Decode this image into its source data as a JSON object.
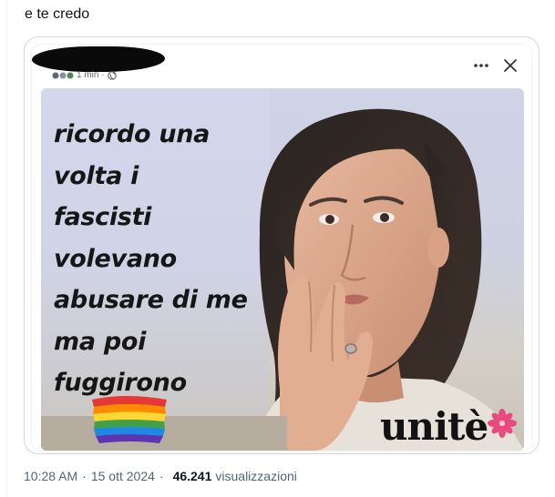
{
  "tweet": {
    "text": "e te credo",
    "time": "10:28 AM",
    "separator": "·",
    "date": "15 ott 2024",
    "views_count": "46.241",
    "views_label": "visualizzazioni"
  },
  "embedded_post": {
    "timestamp": "1 min ·",
    "more_icon": "more-horizontal-icon",
    "close_icon": "close-icon",
    "image": {
      "caption_lines": [
        "ricordo una",
        "volta i",
        "fascisti",
        "volevano",
        "abusare di me",
        "ma poi",
        "fuggirono"
      ],
      "logo_text": "unit",
      "logo_accent": "è",
      "rainbow_colors": [
        "#e53935",
        "#fb8c00",
        "#fdd835",
        "#43a047",
        "#1e88e5",
        "#5e35b1"
      ]
    }
  },
  "colors": {
    "text_primary": "#0f1419",
    "text_secondary": "#536471",
    "border": "#cfd9de",
    "logo_flower": "#e8497f"
  }
}
